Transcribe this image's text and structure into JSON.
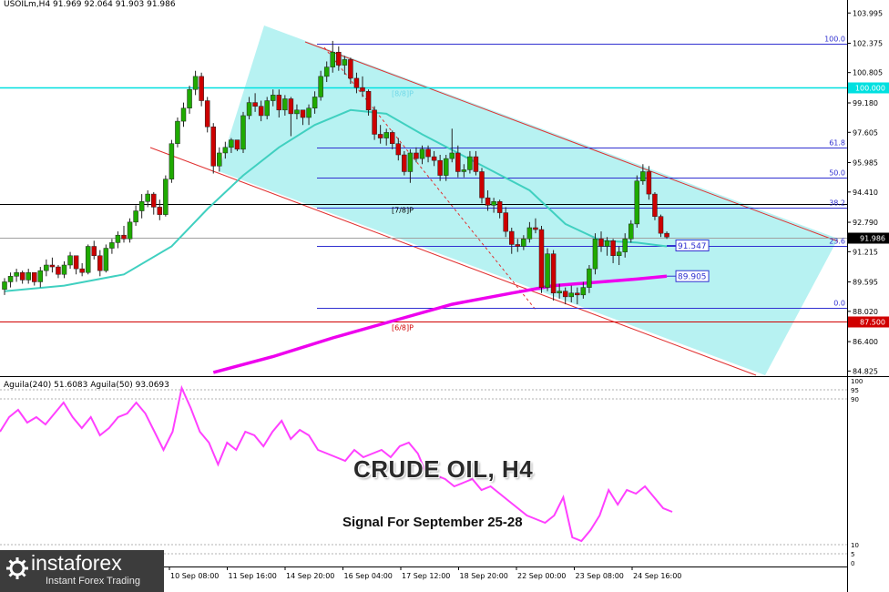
{
  "header": {
    "symbol_line": "USOILm,H4  91.969 92.064 91.903 91.986"
  },
  "oscillator": {
    "header": "Aguila(240) 51.6083  Aguila(50) 93.0693",
    "scale_labels": [
      "100",
      "95",
      "90",
      "10",
      "5",
      "0"
    ]
  },
  "annotations": {
    "title": "CRUDE OIL, H4",
    "subtitle": "Signal For September 25-28"
  },
  "branding": {
    "logo_main": "instaforex",
    "logo_sub": "Instant Forex Trading"
  },
  "colors": {
    "channel_fill": "#aaf0f0",
    "bull_candle": "#1faa00",
    "bear_candle": "#cc0000",
    "ma_fast": "#40d0c0",
    "ma_slow": "#ee00ee",
    "fib_line": "#3030d0",
    "channel_line": "#e03030",
    "murray_cyan": "#00e0e0",
    "murray_red": "#d00000",
    "oscillator": "#ff40ff"
  },
  "chart_data": {
    "type": "candlestick",
    "price_axis_labels": [
      "103.995",
      "102.375",
      "100.805",
      "99.180",
      "97.605",
      "95.985",
      "94.410",
      "92.790",
      "91.215",
      "89.595",
      "88.020",
      "86.400",
      "84.825"
    ],
    "time_axis_labels": [
      "10 Sep 08:00",
      "11 Sep 16:00",
      "14 Sep 20:00",
      "16 Sep 04:00",
      "17 Sep 12:00",
      "18 Sep 20:00",
      "22 Sep 00:00",
      "23 Sep 08:00",
      "24 Sep 16:00"
    ],
    "current_price": "91.986",
    "ylim": [
      84.6,
      104.3
    ],
    "candles": [
      [
        89.2,
        89.8,
        88.9,
        89.6
      ],
      [
        89.6,
        90.1,
        89.3,
        89.9
      ],
      [
        89.9,
        90.3,
        89.6,
        90.1
      ],
      [
        90.1,
        90.2,
        89.5,
        89.7
      ],
      [
        89.7,
        90.3,
        89.5,
        90.1
      ],
      [
        90.1,
        90.0,
        89.4,
        89.6
      ],
      [
        89.6,
        90.4,
        89.3,
        90.2
      ],
      [
        90.2,
        90.8,
        89.9,
        90.5
      ],
      [
        90.5,
        90.9,
        90.1,
        90.4
      ],
      [
        90.4,
        90.5,
        89.8,
        90.0
      ],
      [
        90.0,
        90.7,
        89.8,
        90.5
      ],
      [
        90.5,
        91.2,
        90.3,
        91.0
      ],
      [
        91.0,
        91.0,
        90.0,
        90.3
      ],
      [
        90.3,
        90.6,
        89.9,
        90.1
      ],
      [
        90.1,
        91.6,
        90.0,
        91.5
      ],
      [
        91.5,
        91.8,
        90.8,
        91.0
      ],
      [
        91.0,
        91.3,
        89.9,
        90.2
      ],
      [
        90.2,
        91.6,
        90.1,
        91.4
      ],
      [
        91.4,
        91.9,
        91.1,
        91.7
      ],
      [
        91.7,
        92.3,
        91.4,
        92.1
      ],
      [
        92.1,
        92.6,
        91.7,
        91.9
      ],
      [
        91.9,
        93.0,
        91.7,
        92.8
      ],
      [
        92.8,
        93.7,
        92.6,
        93.4
      ],
      [
        93.4,
        94.3,
        93.0,
        93.9
      ],
      [
        93.9,
        94.5,
        93.6,
        94.3
      ],
      [
        94.3,
        94.4,
        93.2,
        93.6
      ],
      [
        93.6,
        94.0,
        92.9,
        93.2
      ],
      [
        93.2,
        95.3,
        93.1,
        95.1
      ],
      [
        95.1,
        97.2,
        94.9,
        97.0
      ],
      [
        97.0,
        98.4,
        96.8,
        98.2
      ],
      [
        98.2,
        99.2,
        97.9,
        98.9
      ],
      [
        98.9,
        100.1,
        98.6,
        99.9
      ],
      [
        99.9,
        100.9,
        99.6,
        100.6
      ],
      [
        100.6,
        100.8,
        99.0,
        99.3
      ],
      [
        99.3,
        99.5,
        97.6,
        97.9
      ],
      [
        97.9,
        98.1,
        95.4,
        95.8
      ],
      [
        95.8,
        96.8,
        95.5,
        96.5
      ],
      [
        96.5,
        97.1,
        96.2,
        96.8
      ],
      [
        96.8,
        97.3,
        96.5,
        97.2
      ],
      [
        97.2,
        97.0,
        96.6,
        96.7
      ],
      [
        96.7,
        98.7,
        96.5,
        98.5
      ],
      [
        98.5,
        99.5,
        98.3,
        99.2
      ],
      [
        99.2,
        99.7,
        98.7,
        99.0
      ],
      [
        99.0,
        99.3,
        98.2,
        98.5
      ],
      [
        98.5,
        99.5,
        98.3,
        99.3
      ],
      [
        99.3,
        99.9,
        99.0,
        99.6
      ],
      [
        99.6,
        99.9,
        98.4,
        98.8
      ],
      [
        98.8,
        99.6,
        98.5,
        99.4
      ],
      [
        99.4,
        99.5,
        97.4,
        98.6
      ],
      [
        98.6,
        99.1,
        98.3,
        98.8
      ],
      [
        98.8,
        98.8,
        98.0,
        98.4
      ],
      [
        98.4,
        99.1,
        98.0,
        98.9
      ],
      [
        98.9,
        99.8,
        98.6,
        99.5
      ],
      [
        99.5,
        100.9,
        99.3,
        100.6
      ],
      [
        100.6,
        101.4,
        100.3,
        101.1
      ],
      [
        101.1,
        102.5,
        100.8,
        101.9
      ],
      [
        101.9,
        102.2,
        100.9,
        101.2
      ],
      [
        101.2,
        101.7,
        100.7,
        101.5
      ],
      [
        101.5,
        101.6,
        100.2,
        100.5
      ],
      [
        100.5,
        100.8,
        99.7,
        100.0
      ],
      [
        100.0,
        100.6,
        99.5,
        99.8
      ],
      [
        99.8,
        99.9,
        98.5,
        98.8
      ],
      [
        98.8,
        99.0,
        97.2,
        97.5
      ],
      [
        97.5,
        98.0,
        97.0,
        97.3
      ],
      [
        97.3,
        97.8,
        96.9,
        97.6
      ],
      [
        97.6,
        97.7,
        96.7,
        97.0
      ],
      [
        97.0,
        97.3,
        96.1,
        96.4
      ],
      [
        96.4,
        96.6,
        95.3,
        95.5
      ],
      [
        95.5,
        96.7,
        94.9,
        96.5
      ],
      [
        96.5,
        96.8,
        96.0,
        96.2
      ],
      [
        96.2,
        96.9,
        95.9,
        96.7
      ],
      [
        96.7,
        96.9,
        96.0,
        96.3
      ],
      [
        96.3,
        96.6,
        95.8,
        96.1
      ],
      [
        96.1,
        96.4,
        95.0,
        95.3
      ],
      [
        95.3,
        96.4,
        95.0,
        96.2
      ],
      [
        96.2,
        97.8,
        96.0,
        96.5
      ],
      [
        96.5,
        96.9,
        95.2,
        95.5
      ],
      [
        95.5,
        95.9,
        95.2,
        95.6
      ],
      [
        95.6,
        96.6,
        95.4,
        96.3
      ],
      [
        96.3,
        96.6,
        95.3,
        95.5
      ],
      [
        95.5,
        95.7,
        93.8,
        94.1
      ],
      [
        94.1,
        94.5,
        93.4,
        93.7
      ],
      [
        93.7,
        94.1,
        93.3,
        93.9
      ],
      [
        93.9,
        94.0,
        93.0,
        93.3
      ],
      [
        93.3,
        93.6,
        92.0,
        92.3
      ],
      [
        92.3,
        92.5,
        91.1,
        91.6
      ],
      [
        91.6,
        91.9,
        91.2,
        91.5
      ],
      [
        91.5,
        92.1,
        91.3,
        91.9
      ],
      [
        91.9,
        92.8,
        91.7,
        92.5
      ],
      [
        92.5,
        93.0,
        92.2,
        92.4
      ],
      [
        92.4,
        92.6,
        89.0,
        89.3
      ],
      [
        89.3,
        91.4,
        89.1,
        91.1
      ],
      [
        91.1,
        91.3,
        88.6,
        89.0
      ],
      [
        89.0,
        89.5,
        88.7,
        89.1
      ],
      [
        89.1,
        89.3,
        88.4,
        88.8
      ],
      [
        88.8,
        89.4,
        88.5,
        89.0
      ],
      [
        89.0,
        89.3,
        88.4,
        88.9
      ],
      [
        88.9,
        89.6,
        88.7,
        89.3
      ],
      [
        89.3,
        90.5,
        89.0,
        90.3
      ],
      [
        90.3,
        92.2,
        90.0,
        91.9
      ],
      [
        91.9,
        92.3,
        91.2,
        91.5
      ],
      [
        91.5,
        92.0,
        91.0,
        91.8
      ],
      [
        91.8,
        91.9,
        90.6,
        91.0
      ],
      [
        91.0,
        91.5,
        90.5,
        91.2
      ],
      [
        91.2,
        92.2,
        90.9,
        91.9
      ],
      [
        91.9,
        92.9,
        91.7,
        92.7
      ],
      [
        92.7,
        95.3,
        92.5,
        95.0
      ],
      [
        95.0,
        95.9,
        94.8,
        95.5
      ],
      [
        95.5,
        95.8,
        94.0,
        94.3
      ],
      [
        94.3,
        94.4,
        92.9,
        93.1
      ],
      [
        93.1,
        93.2,
        92.0,
        92.2
      ],
      [
        92.2,
        92.3,
        91.9,
        92.0
      ]
    ],
    "ma_fast": {
      "name": "",
      "points": [
        [
          0,
          89.1
        ],
        [
          10,
          89.4
        ],
        [
          20,
          90.0
        ],
        [
          28,
          91.5
        ],
        [
          34,
          93.5
        ],
        [
          40,
          95.3
        ],
        [
          46,
          96.8
        ],
        [
          52,
          98.0
        ],
        [
          58,
          98.8
        ],
        [
          64,
          98.6
        ],
        [
          70,
          97.5
        ],
        [
          76,
          96.5
        ],
        [
          82,
          95.5
        ],
        [
          88,
          94.5
        ],
        [
          94,
          92.7
        ],
        [
          100,
          91.8
        ],
        [
          106,
          91.7
        ],
        [
          111,
          91.5
        ]
      ]
    },
    "ma_slow": {
      "name": "",
      "points": [
        [
          35,
          84.75
        ],
        [
          45,
          85.6
        ],
        [
          55,
          86.6
        ],
        [
          65,
          87.5
        ],
        [
          75,
          88.4
        ],
        [
          85,
          89.0
        ],
        [
          92,
          89.4
        ],
        [
          100,
          89.6
        ],
        [
          106,
          89.75
        ],
        [
          111,
          89.9
        ]
      ]
    },
    "fibonacci_levels": [
      {
        "label": "100.0",
        "value": 102.35
      },
      {
        "label": "61.8",
        "value": 96.8
      },
      {
        "label": "50.0",
        "value": 95.2
      },
      {
        "label": "38.2",
        "value": 93.55
      },
      {
        "label": "23.6",
        "value": 91.5
      },
      {
        "label": "0.0",
        "value": 88.2
      }
    ],
    "murray_levels": [
      {
        "label": "[8/8]P",
        "value": 100.0,
        "tag": "100.000",
        "color": "cyan"
      },
      {
        "label": "[7/8]P",
        "value": 93.75,
        "tag": "",
        "color": "black"
      },
      {
        "label": "[6/8]P",
        "value": 87.5,
        "tag": "87.500",
        "color": "red"
      }
    ],
    "price_tags": [
      {
        "label": "91.547",
        "value": 91.547
      },
      {
        "label": "89.905",
        "value": 89.905
      }
    ],
    "oscillator": {
      "type": "line",
      "ylim": [
        0,
        100
      ],
      "values": [
        72,
        80,
        84,
        77,
        80,
        76,
        82,
        88,
        80,
        74,
        80,
        70,
        74,
        80,
        82,
        88,
        82,
        72,
        62,
        72,
        96,
        85,
        72,
        66,
        54,
        66,
        62,
        72,
        70,
        64,
        72,
        78,
        68,
        73,
        70,
        62,
        60,
        58,
        56,
        62,
        58,
        60,
        62,
        58,
        64,
        66,
        60,
        48,
        48,
        46,
        42,
        44,
        46,
        40,
        42,
        38,
        34,
        30,
        26,
        24,
        22,
        26,
        36,
        14,
        12,
        18,
        26,
        40,
        32,
        40,
        38,
        42,
        36,
        30,
        28
      ]
    }
  }
}
